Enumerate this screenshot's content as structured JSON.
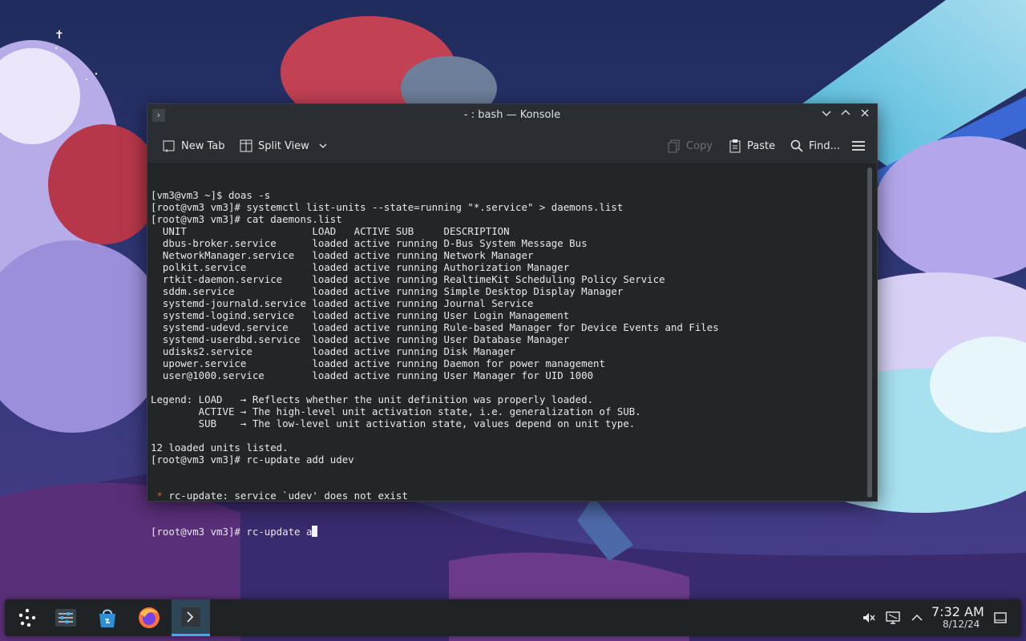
{
  "window": {
    "title": "- : bash — Konsole"
  },
  "toolbar": {
    "new_tab": "New Tab",
    "split_view": "Split View",
    "copy": "Copy",
    "paste": "Paste",
    "find": "Find..."
  },
  "terminal": {
    "lines": [
      "[vm3@vm3 ~]$ doas -s",
      "[root@vm3 vm3]# systemctl list-units --state=running \"*.service\" > daemons.list",
      "[root@vm3 vm3]# cat daemons.list",
      "  UNIT                     LOAD   ACTIVE SUB     DESCRIPTION",
      "  dbus-broker.service      loaded active running D-Bus System Message Bus",
      "  NetworkManager.service   loaded active running Network Manager",
      "  polkit.service           loaded active running Authorization Manager",
      "  rtkit-daemon.service     loaded active running RealtimeKit Scheduling Policy Service",
      "  sddm.service             loaded active running Simple Desktop Display Manager",
      "  systemd-journald.service loaded active running Journal Service",
      "  systemd-logind.service   loaded active running User Login Management",
      "  systemd-udevd.service    loaded active running Rule-based Manager for Device Events and Files",
      "  systemd-userdbd.service  loaded active running User Database Manager",
      "  udisks2.service          loaded active running Disk Manager",
      "  upower.service           loaded active running Daemon for power management",
      "  user@1000.service        loaded active running User Manager for UID 1000",
      "",
      "Legend: LOAD   → Reflects whether the unit definition was properly loaded.",
      "        ACTIVE → The high-level unit activation state, i.e. generalization of SUB.",
      "        SUB    → The low-level unit activation state, values depend on unit type.",
      "",
      "12 loaded units listed.",
      "[root@vm3 vm3]# rc-update add udev"
    ],
    "error_star": " *",
    "error_text": " rc-update: service `udev' does not exist",
    "prompt_line": "[root@vm3 vm3]# rc-update a"
  },
  "taskbar": {
    "items": [
      {
        "icon": "application-launcher-icon"
      },
      {
        "icon": "system-settings-icon"
      },
      {
        "icon": "discover-store-icon"
      },
      {
        "icon": "firefox-icon"
      },
      {
        "icon": "konsole-icon"
      }
    ],
    "clock_time": "7:32 AM",
    "clock_date": "8/12/24"
  }
}
